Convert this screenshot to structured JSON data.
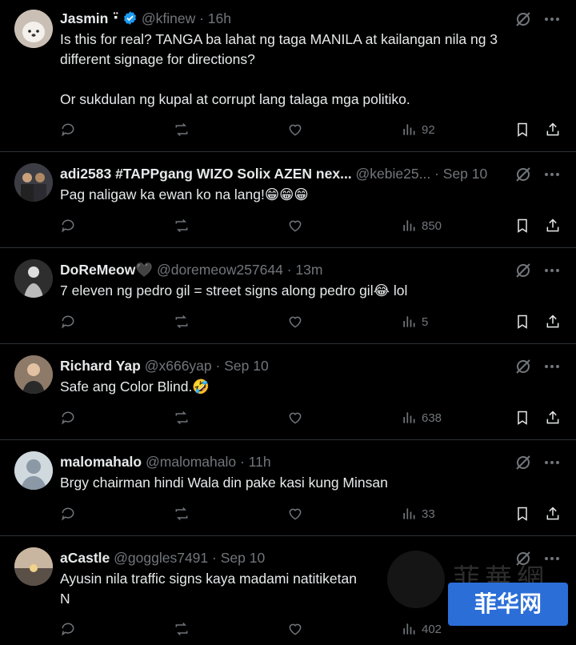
{
  "tweets": [
    {
      "name": "Jasmin",
      "name_suffix": "⠐̈",
      "verified": true,
      "handle": "@kfinew",
      "time": "· 16h",
      "text": "Is this for real? TANGA ba lahat ng taga MANILA at kailangan nila ng 3\ndifferent signage for directions?\n\nOr sukdulan ng kupal at corrupt lang talaga mga politiko.",
      "views": "92",
      "avatar_color": "#d9cfc4"
    },
    {
      "name": "adi2583 #TAPPgang WIZO Solix AZEN nex...",
      "verified": false,
      "handle": "@kebie25...",
      "time": "· Sep 10",
      "text": "Pag naligaw ka ewan ko na lang!😁😁😁",
      "views": "850",
      "avatar_color": "#4a4a52"
    },
    {
      "name": "DoReMeow🖤",
      "verified": false,
      "handle": "@doremeow257644",
      "time": "· 13m",
      "text": "7 eleven ng pedro gil = street signs along pedro gil😂 lol",
      "views": "5",
      "avatar_color": "#3a3a3a"
    },
    {
      "name": "Richard Yap",
      "verified": false,
      "handle": "@x666yap",
      "time": "· Sep 10",
      "text": "Safe ang Color Blind.🤣",
      "views": "638",
      "avatar_color": "#6b5a4e"
    },
    {
      "name": "malomahalo",
      "verified": false,
      "handle": "@malomahalo",
      "time": "· 11h",
      "text": "Brgy chairman hindi Wala din pake kasi kung Minsan",
      "views": "33",
      "avatar_color": "#8b98a5"
    },
    {
      "name": "aCastle",
      "verified": false,
      "handle": "@goggles7491",
      "time": "· Sep 10",
      "text": "Ayusin nila traffic signs kaya madami natitiketan\nN",
      "views": "402",
      "avatar_color": "#9a8a7a"
    }
  ],
  "watermark": {
    "text": "菲华网",
    "faded_text": "菲華網"
  },
  "colors": {
    "background": "#000000",
    "text": "#e7e9ea",
    "muted": "#71767b",
    "divider": "#2f3336",
    "verified": "#1d9bf0"
  },
  "icons": {
    "reply": "reply-icon",
    "repost": "repost-icon",
    "like": "like-icon",
    "views": "views-icon",
    "bookmark": "bookmark-icon",
    "share": "share-icon",
    "grok": "grok-icon",
    "more": "more-icon"
  }
}
